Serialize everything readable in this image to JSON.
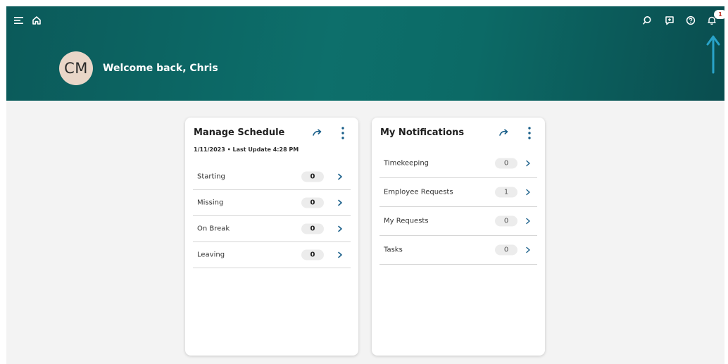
{
  "header": {
    "welcome_text": "Welcome back, Chris",
    "avatar_initials": "CM",
    "notification_count": "1",
    "icons": [
      "menu-icon",
      "home-icon",
      "search-icon",
      "chat-icon",
      "help-icon",
      "bell-icon"
    ]
  },
  "cards": {
    "schedule": {
      "title": "Manage Schedule",
      "subtitle": "1/11/2023 • Last Update 4:28 PM",
      "rows": [
        {
          "label": "Starting",
          "count": "0"
        },
        {
          "label": "Missing",
          "count": "0"
        },
        {
          "label": "On Break",
          "count": "0"
        },
        {
          "label": "Leaving",
          "count": "0"
        }
      ]
    },
    "notifications": {
      "title": "My Notifications",
      "rows": [
        {
          "label": "Timekeeping",
          "count": "0"
        },
        {
          "label": "Employee Requests",
          "count": "1"
        },
        {
          "label": "My Requests",
          "count": "0"
        },
        {
          "label": "Tasks",
          "count": "0"
        }
      ]
    }
  },
  "colors": {
    "header_bg": "#0c6a66",
    "accent": "#1a5f8a",
    "avatar_bg": "#e9d6c8",
    "annotation_arrow": "#29a3c9"
  }
}
